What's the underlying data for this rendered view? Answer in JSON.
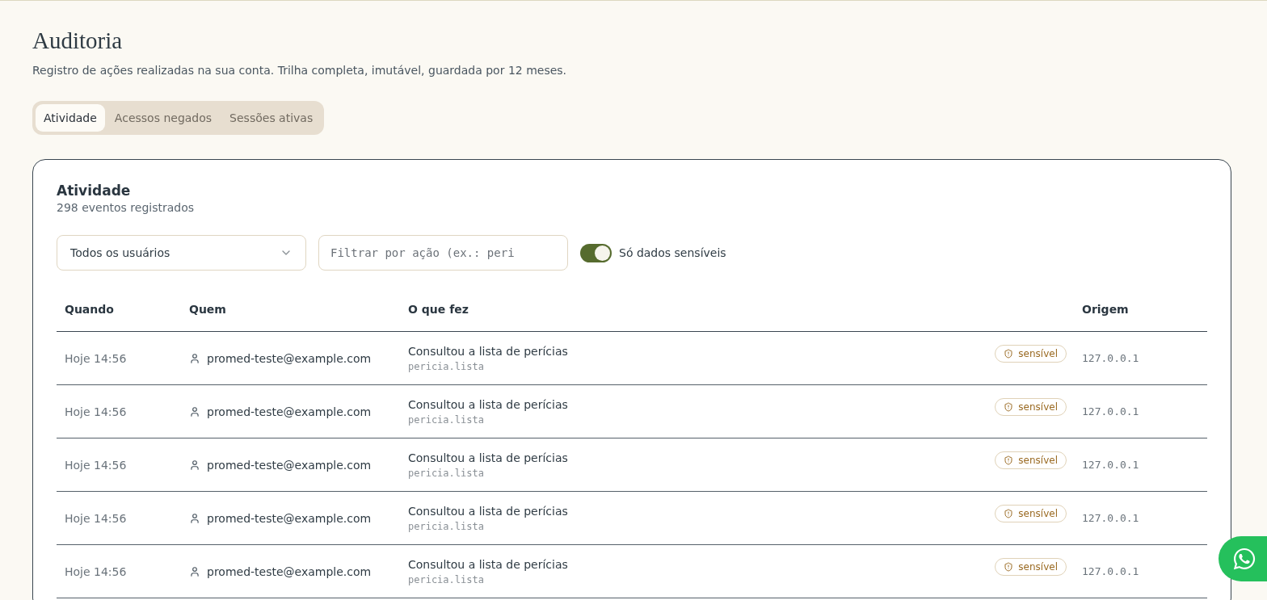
{
  "page": {
    "title": "Auditoria",
    "subtitle": "Registro de ações realizadas na sua conta. Trilha completa, imutável, guardada por 12 meses."
  },
  "tabs": [
    {
      "label": "Atividade",
      "selected": true
    },
    {
      "label": "Acessos negados",
      "selected": false
    },
    {
      "label": "Sessões ativas",
      "selected": false
    }
  ],
  "card": {
    "title": "Atividade",
    "count": "298 eventos registrados"
  },
  "filters": {
    "user_select": "Todos os usuários",
    "action_search": {
      "placeholder": "Filtrar por ação (ex.: peri"
    },
    "sensitive_toggle": {
      "label": "Só dados sensíveis",
      "on": true
    }
  },
  "table": {
    "columns": [
      "Quando",
      "Quem",
      "O que fez",
      "Origem"
    ],
    "rows": [
      {
        "when": "Hoje 14:56",
        "who": "promed-teste@example.com",
        "action": "Consultou a lista de perícias",
        "code": "pericia.lista",
        "badge": "sensível",
        "origin": "127.0.0.1"
      },
      {
        "when": "Hoje 14:56",
        "who": "promed-teste@example.com",
        "action": "Consultou a lista de perícias",
        "code": "pericia.lista",
        "badge": "sensível",
        "origin": "127.0.0.1"
      },
      {
        "when": "Hoje 14:56",
        "who": "promed-teste@example.com",
        "action": "Consultou a lista de perícias",
        "code": "pericia.lista",
        "badge": "sensível",
        "origin": "127.0.0.1"
      },
      {
        "when": "Hoje 14:56",
        "who": "promed-teste@example.com",
        "action": "Consultou a lista de perícias",
        "code": "pericia.lista",
        "badge": "sensível",
        "origin": "127.0.0.1"
      },
      {
        "when": "Hoje 14:56",
        "who": "promed-teste@example.com",
        "action": "Consultou a lista de perícias",
        "code": "pericia.lista",
        "badge": "sensível",
        "origin": "127.0.0.1"
      }
    ]
  }
}
